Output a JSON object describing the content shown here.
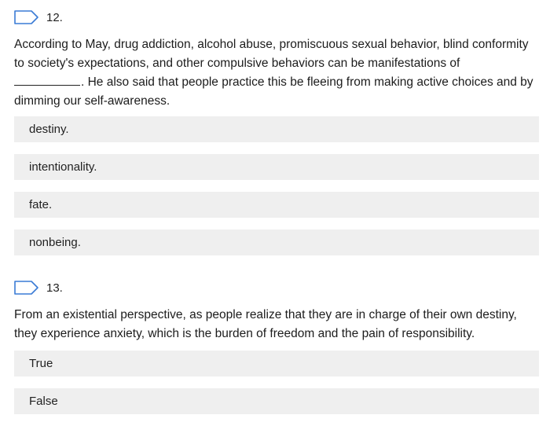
{
  "q12": {
    "number": "12.",
    "text_before": "According to May, drug addiction, alcohol abuse, promiscuous sexual behavior, blind conformity to society's expectations, and other compulsive behaviors can be manifestations of",
    "text_after": ". He also said that people practice this be fleeing from making active choices and by dimming our self-awareness.",
    "options": [
      "destiny.",
      "intentionality.",
      "fate.",
      "nonbeing."
    ]
  },
  "q13": {
    "number": "13.",
    "text": "From an existential perspective, as people realize that they are in charge of their own destiny, they experience anxiety, which is the burden of freedom and the pain of responsibility.",
    "options": [
      "True",
      "False"
    ]
  },
  "colors": {
    "flag_stroke": "#3a7bd5",
    "option_background": "#efefef",
    "text": "#1c1c1c"
  },
  "icons": {
    "flag": "flag-outline-icon"
  }
}
